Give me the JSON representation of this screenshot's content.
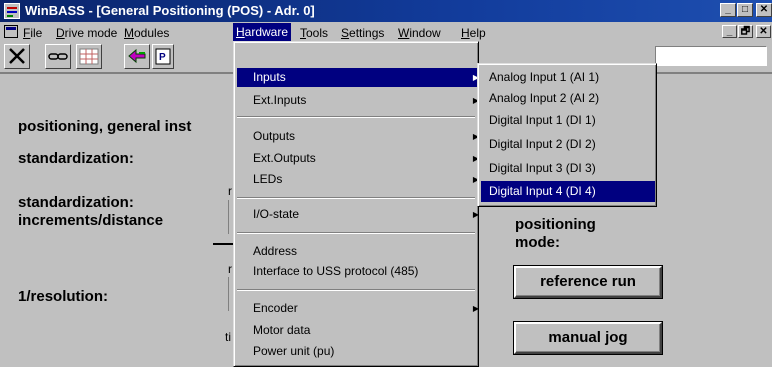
{
  "window": {
    "title": "WinBASS - [General Positioning (POS) - Adr. 0]",
    "min_glyph": "_",
    "max_glyph": "□",
    "close_glyph": "✕"
  },
  "menubar": {
    "items": [
      {
        "label": "File",
        "hotkey": "F",
        "rest": "ile"
      },
      {
        "label": "Drive mode",
        "hotkey": "D",
        "rest": "rive mode"
      },
      {
        "label": "Modules",
        "hotkey": "M",
        "rest": "odules"
      },
      {
        "label": "Hardware",
        "hotkey": "H",
        "rest": "ardware"
      },
      {
        "label": "Tools",
        "hotkey": "T",
        "rest": "ools"
      },
      {
        "label": "Settings",
        "hotkey": "S",
        "rest": "ettings"
      },
      {
        "label": "Window",
        "hotkey": "W",
        "rest": "indow"
      },
      {
        "label": "Help",
        "hotkey": "H",
        "rest": "elp"
      }
    ],
    "mdi_min": "_",
    "mdi_restore": "🗗",
    "mdi_close": "✕"
  },
  "toolbar": {
    "icons": [
      "close-x-icon",
      "link-icon",
      "grid-icon",
      "arrow-left-icon",
      "parameter-icon"
    ]
  },
  "main": {
    "positioning_general": "positioning, general inst",
    "standardization": "standardization:",
    "standardization_inc_1": "standardization:",
    "standardization_inc_2": "increments/distance",
    "resolution": "1/resolution:",
    "frag_r1": "r",
    "frag_r2": "r",
    "frag_ti": "ti",
    "positioning_mode_1": "positioning",
    "positioning_mode_2": "mode:",
    "reference_run": "reference run",
    "manual_jog": "manual jog"
  },
  "hardware_menu": {
    "items": [
      {
        "label": "Inputs",
        "submenu": true,
        "highlighted": true
      },
      {
        "label": "Ext.Inputs",
        "submenu": true
      },
      {
        "label": "Outputs",
        "submenu": true
      },
      {
        "label": "Ext.Outputs",
        "submenu": true
      },
      {
        "label": "LEDs",
        "submenu": true
      },
      {
        "label": "I/O-state",
        "submenu": true
      },
      {
        "label": "Address",
        "submenu": false
      },
      {
        "label": "Interface to USS protocol (485)",
        "submenu": false
      },
      {
        "label": "Encoder",
        "submenu": true
      },
      {
        "label": "Motor data",
        "submenu": false
      },
      {
        "label": "Power unit (pu)",
        "submenu": false
      }
    ]
  },
  "inputs_submenu": {
    "items": [
      {
        "label": "Analog Input 1 (AI 1)"
      },
      {
        "label": "Analog Input 2 (AI 2)"
      },
      {
        "label": "Digital Input 1 (DI 1)"
      },
      {
        "label": "Digital Input 2 (DI 2)"
      },
      {
        "label": "Digital Input 3 (DI 3)"
      },
      {
        "label": "Digital Input 4 (DI 4)",
        "highlighted": true
      }
    ]
  },
  "colors": {
    "titlebar": "#0a246a",
    "highlight": "#000080",
    "face": "#c0c0c0"
  }
}
